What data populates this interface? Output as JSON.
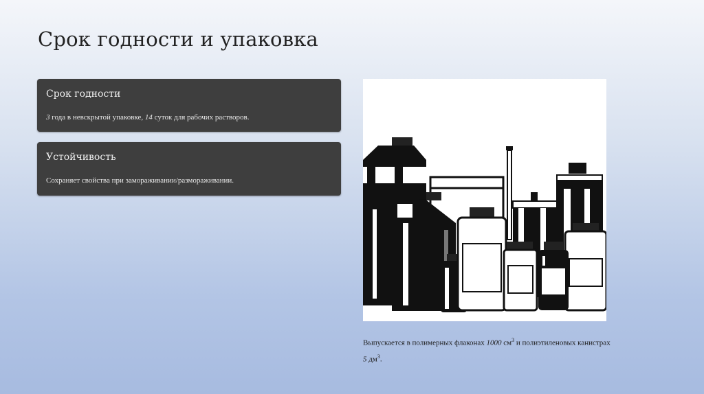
{
  "slide": {
    "title": "Срок годности и упаковка"
  },
  "cards": [
    {
      "title": "Срок годности",
      "text_num1": "3",
      "text_part1": " года в невскрытой упаковке, ",
      "text_num2": "14",
      "text_part2": " суток для рабочих растворов."
    },
    {
      "title": "Устойчивость",
      "text": "Сохраняет свойства при замораживании/размораживании."
    }
  ],
  "caption": {
    "part1": "Выпускается в полимерных флаконах ",
    "num1": "1000",
    "unit1": " см",
    "sup1": "3",
    "part2": " и полиэтиленовых канистрах",
    "num2": "5",
    "unit2": " дм",
    "sup2": "3",
    "end": "."
  },
  "image": {
    "icon": "bottles-and-canisters-illustration"
  }
}
